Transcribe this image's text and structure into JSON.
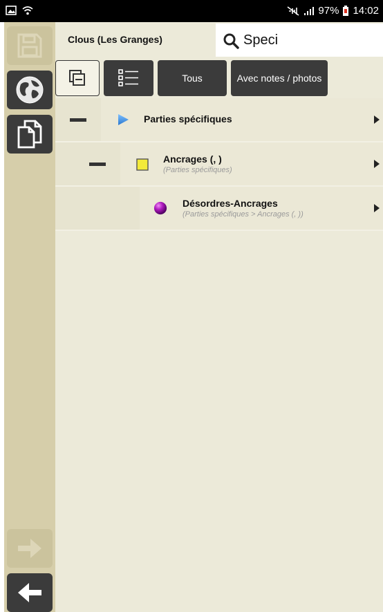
{
  "status_bar": {
    "battery": "97%",
    "time": "14:02",
    "icons": [
      "image-icon",
      "wifi-icon",
      "mute-icon",
      "signal-icon",
      "battery-icon"
    ]
  },
  "sidebar": {
    "buttons": [
      {
        "icon": "save-icon",
        "enabled": false
      },
      {
        "icon": "globe-icon",
        "enabled": true
      },
      {
        "icon": "copy-documents-icon",
        "enabled": true
      },
      {
        "icon": "arrow-right-icon",
        "enabled": false
      },
      {
        "icon": "arrow-left-icon",
        "enabled": true
      }
    ]
  },
  "header": {
    "title": "Clous (Les Granges)",
    "search_value": "Speci"
  },
  "toolbar": {
    "collapse_icon": "collapse-all-icon",
    "list_icon": "list-view-icon",
    "all_label": "Tous",
    "with_notes_label": "Avec notes / photos"
  },
  "tree": [
    {
      "title": "Parties spécifiques",
      "subtitle": "",
      "icon": "blue-triangle-icon",
      "level": 0
    },
    {
      "title": "Ancrages (, )",
      "subtitle": "(Parties spécifiques)",
      "icon": "yellow-square-icon",
      "level": 1
    },
    {
      "title": "Désordres-Ancrages",
      "subtitle": "(Parties spécifiques > Ancrages (, ))",
      "icon": "purple-sphere-icon",
      "level": 2
    }
  ],
  "colors": {
    "sidebar_bg": "#d6ceaa",
    "main_bg": "#ecead9",
    "dark_button": "#3b3b3b",
    "triangle_blue": "#3a8fe0",
    "square_yellow": "#f3ea3a",
    "sphere_purple": "#a00fb0"
  }
}
